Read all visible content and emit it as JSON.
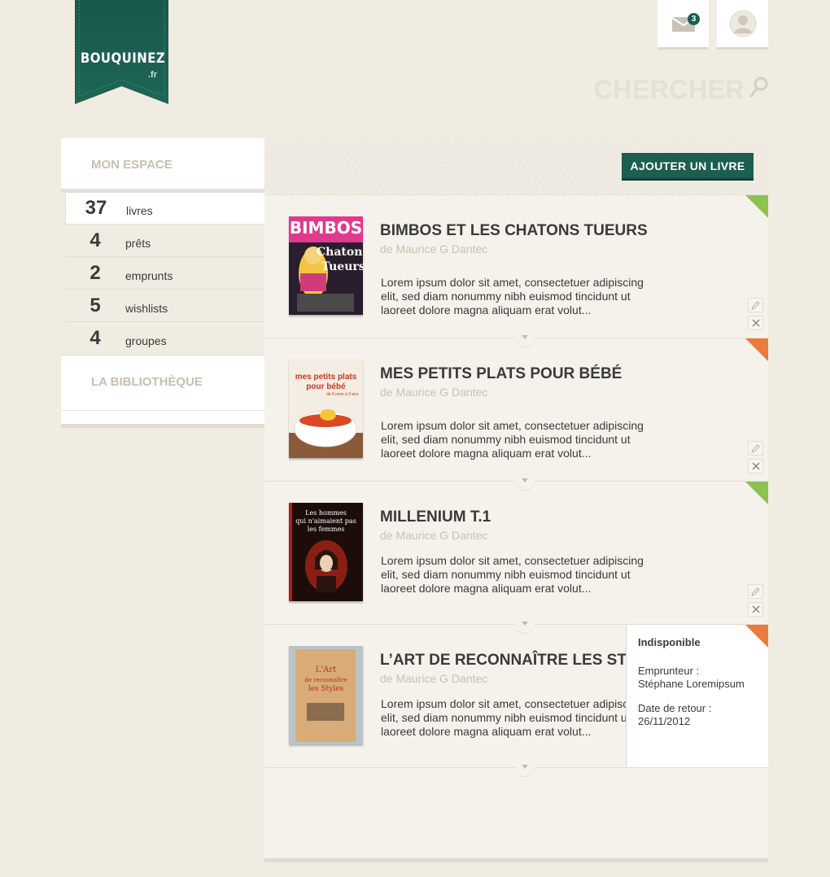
{
  "logo": {
    "brand": "BOUQUINEZ",
    "tld": ".fr"
  },
  "header": {
    "mail_count": "3",
    "search_label": "CHERCHER"
  },
  "sidebar": {
    "head": "MON ESPACE",
    "items": [
      {
        "num": "37",
        "label": "livres"
      },
      {
        "num": "4",
        "label": "prêts"
      },
      {
        "num": "2",
        "label": "emprunts"
      },
      {
        "num": "5",
        "label": "wishlists"
      },
      {
        "num": "4",
        "label": "groupes"
      }
    ],
    "foot": "LA BIBLIOTHÈQUE"
  },
  "main": {
    "add_label": "AJOUTER UN LIVRE"
  },
  "books": [
    {
      "title": "BIMBOS ET LES CHATONS TUEURS",
      "author": "de Maurice G Dantec",
      "desc": "Lorem ipsum dolor sit amet, consectetuer adipiscing elit, sed diam nonummy nibh euismod tincidunt ut laoreet dolore magna aliquam erat volut...",
      "status_color": "#8cc252"
    },
    {
      "title": "MES PETITS PLATS POUR BÉBÉ",
      "author": "de Maurice G Dantec",
      "desc": "Lorem ipsum dolor sit amet, consectetuer adipiscing elit, sed diam nonummy nibh euismod tincidunt ut laoreet dolore magna aliquam erat volut...",
      "status_color": "#ec7a3c"
    },
    {
      "title": "MILLENIUM T.1",
      "author": "de Maurice G Dantec",
      "desc": "Lorem ipsum dolor sit amet, consectetuer adipiscing elit, sed diam nonummy nibh euismod tincidunt ut laoreet dolore magna aliquam erat volut...",
      "status_color": "#8cc252"
    },
    {
      "title": "L’ART DE RECONNAÎTRE LES STYLES",
      "author": "de Maurice G Dantec",
      "desc": "Lorem ipsum dolor sit amet, consectetuer adipiscing elit, sed diam nonummy nibh euismod tincidunt ut laoreet dolore magna aliquam erat volut...",
      "status_color": "#ec7a3c"
    }
  ],
  "covers": {
    "bimbos": {
      "top": "BIMBOS",
      "mid": "Chatons",
      "bot": "Tueurs"
    },
    "plats": {
      "line1": "mes petits plats",
      "line2": "pour bébé",
      "sub": "de 6 mois à 3 ans"
    },
    "millenium": {
      "line1": "Les hommes",
      "line2": "qui n'aimaient pas",
      "line3": "les femmes"
    },
    "art": {
      "line1": "L'Art",
      "line2": "de reconnaître",
      "line3": "les Styles"
    }
  },
  "popover": {
    "title": "Indisponible",
    "borrower_label": "Emprunteur :",
    "borrower_name": "Stéphane Loremipsum",
    "return_label": "Date de retour :",
    "return_date": "26/11/2012"
  },
  "colors": {
    "brand": "#1c5e50",
    "available": "#8cc252",
    "unavailable": "#ec7a3c"
  }
}
